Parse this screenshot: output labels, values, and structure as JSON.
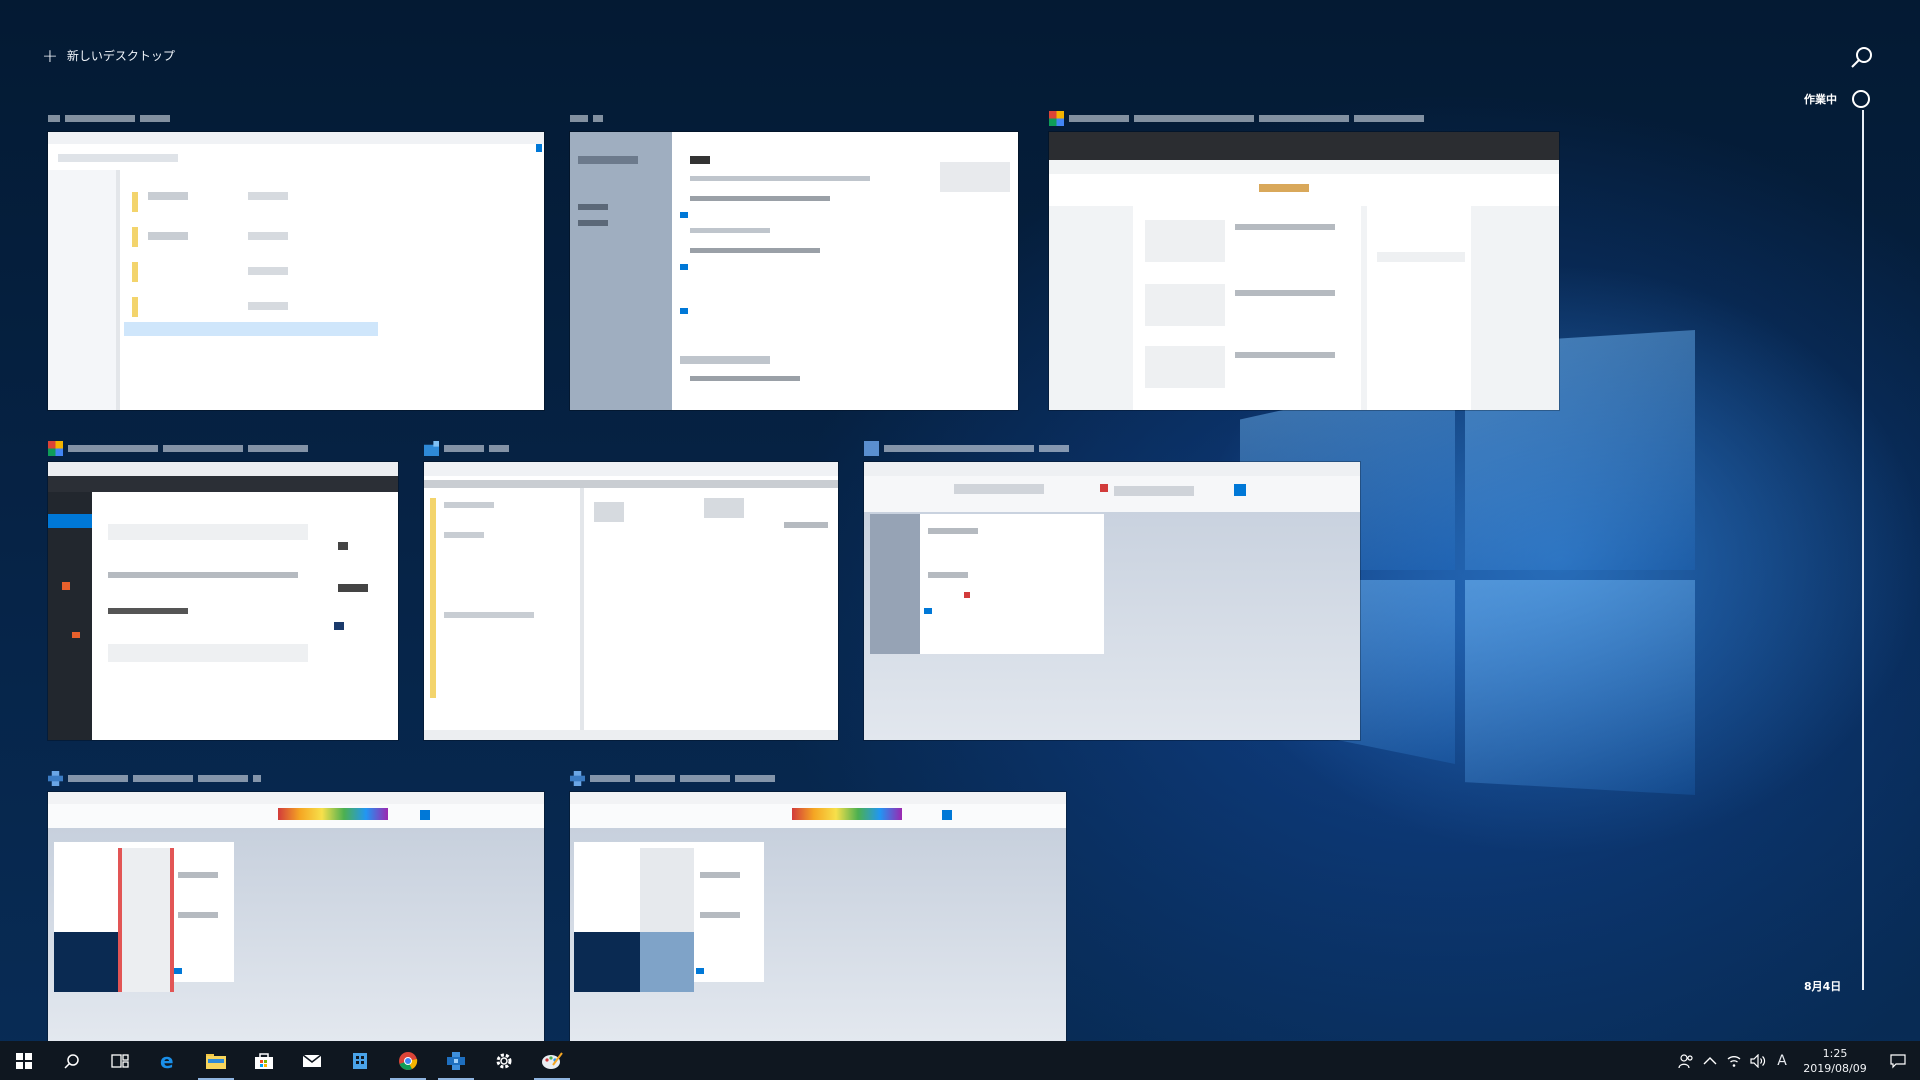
{
  "header": {
    "new_desktop_label": "新しいデスクトップ",
    "plus_icon": "+",
    "search_icon": "search-icon"
  },
  "timeline": {
    "now_label": "作業中",
    "date_label": "8月4日"
  },
  "taskbar": {
    "apps": [
      "start-icon",
      "search-icon",
      "task-view-icon",
      "edge-icon",
      "file-explorer-icon",
      "store-icon",
      "mail-icon",
      "office-icon",
      "chrome-icon",
      "app-icon",
      "settings-icon",
      "paint-icon"
    ],
    "tray": {
      "people_icon": "people-icon",
      "chevron_icon": "chevron-up-icon",
      "network_icon": "network-icon",
      "volume_icon": "volume-icon",
      "ime_label": "A",
      "time": "1:25",
      "date": "2019/08/09"
    }
  },
  "colors": {
    "accent": "#0078d7",
    "taskbar_bg": "#0f1720",
    "folder_yellow": "#f3d46c"
  }
}
